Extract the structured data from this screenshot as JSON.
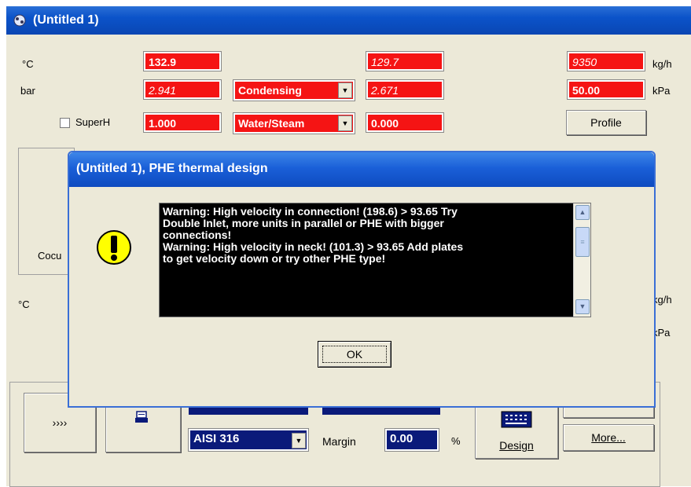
{
  "window": {
    "title": "(Untitled 1)"
  },
  "row1": {
    "unit_left": "°C",
    "value1": "132.9",
    "value2": "129.7",
    "value3": "9350",
    "unit_right": "kg/h"
  },
  "row2": {
    "unit_left": "bar",
    "value1": "2.941",
    "phase_select": "Condensing",
    "value2": "2.671",
    "value3": "50.00",
    "unit_right": "kPa"
  },
  "row3": {
    "superh_label": "SuperH",
    "value1": "1.000",
    "fluid_select": "Water/Steam",
    "value2": "0.000",
    "profile_button": "Profile"
  },
  "left_panel": {
    "partial_label": "Cocu",
    "unit_c": "°C"
  },
  "right_panel": {
    "unit_kgh": "kg/h",
    "unit_kpa": "kPa"
  },
  "bottom": {
    "arrow_button": "››››",
    "material_select": "AISI 316",
    "margin_label": "Margin",
    "margin_value": "0.00",
    "margin_unit": "%",
    "design_button": "Design",
    "more_button": "More..."
  },
  "dialog": {
    "title": "(Untitled 1), PHE thermal design",
    "message": "Warning: High velocity in connection! (198.6) > 93.65 Try\nDouble Inlet, more units in parallel or PHE with bigger\nconnections!\nWarning: High velocity in neck! (101.3) > 93.65 Add plates\nto get velocity down or try other PHE type!",
    "ok_label": "OK",
    "icon": "exclamation-icon"
  },
  "colors": {
    "field_red": "#f51414",
    "field_blue": "#0a1a7a",
    "titlebar_blue": "#0b53c9"
  }
}
